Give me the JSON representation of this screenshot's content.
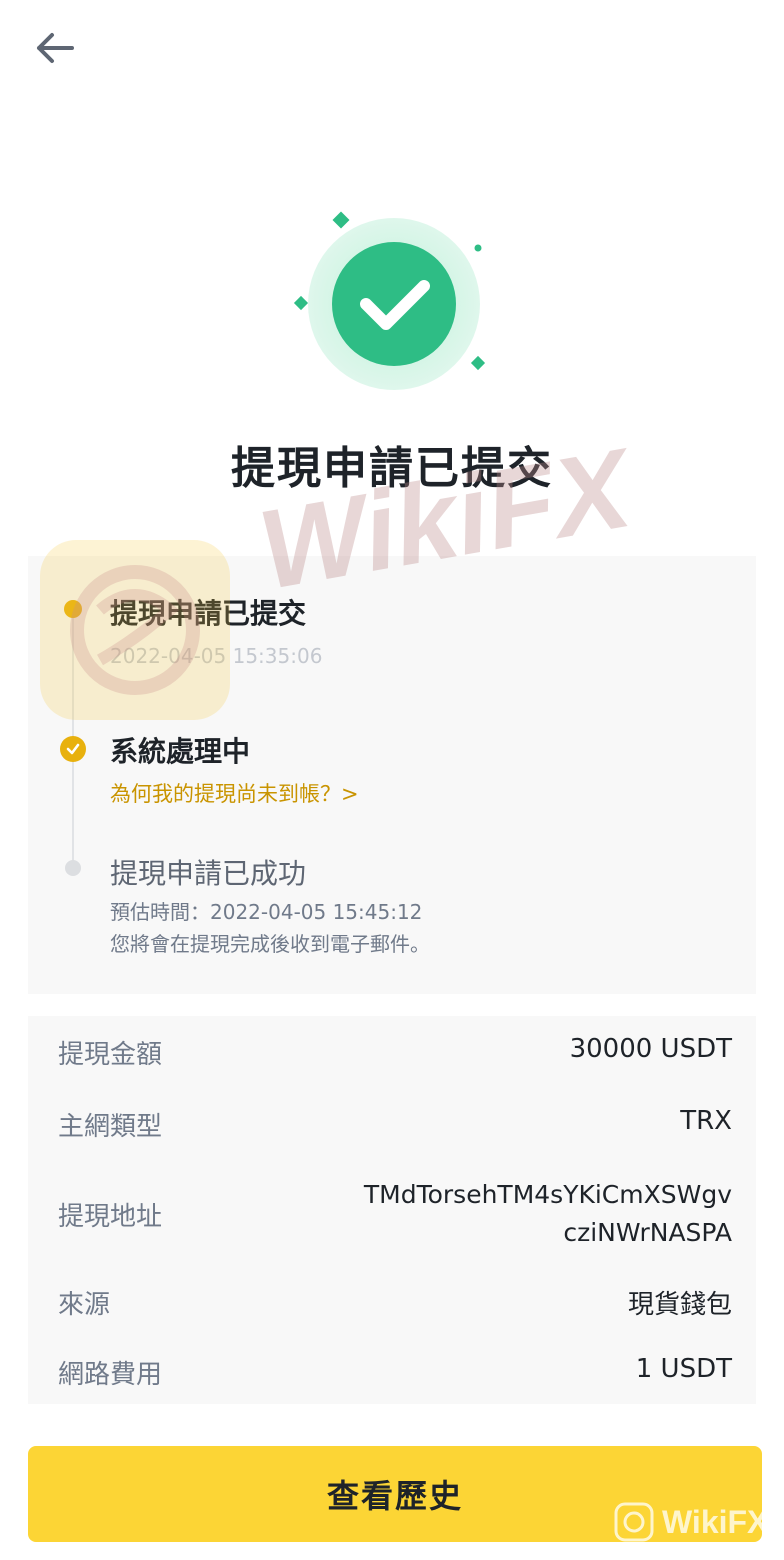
{
  "nav": {
    "back_icon": "arrow-left-icon"
  },
  "hero": {
    "icon": "check-circle-icon",
    "title": "提現申請已提交"
  },
  "timeline": {
    "steps": [
      {
        "title": "提現申請已提交",
        "time": "2022-04-05 15:35:06",
        "status": "done",
        "dot_color": "#E8B10E"
      },
      {
        "title": "系統處理中",
        "link": "為何我的提現尚未到帳？>",
        "status": "active",
        "dot_color": "#E8B10E"
      },
      {
        "title": "提現申請已成功",
        "estimate": "預估時間：2022-04-05 15:45:12",
        "note": "您將會在提現完成後收到電子郵件。",
        "status": "pending",
        "dot_color": "#DCDEE1"
      }
    ]
  },
  "details": {
    "rows": [
      {
        "label": "提現金額",
        "value": "30000 USDT"
      },
      {
        "label": "主網類型",
        "value": "TRX"
      },
      {
        "label": "提現地址",
        "value_line1": "TMdTorsehTM4sYKiCmXSWgv",
        "value_line2": "cziNWrNASPA"
      },
      {
        "label": "來源",
        "value": "現貨錢包"
      },
      {
        "label": "網路費用",
        "value": "1 USDT"
      }
    ]
  },
  "actions": {
    "history_label": "查看歷史"
  },
  "watermark": {
    "text": "WikiFX",
    "small_text": "WikiFX"
  },
  "colors": {
    "accent": "#FCD535",
    "link": "#C99400",
    "success": "#2EBD85"
  }
}
